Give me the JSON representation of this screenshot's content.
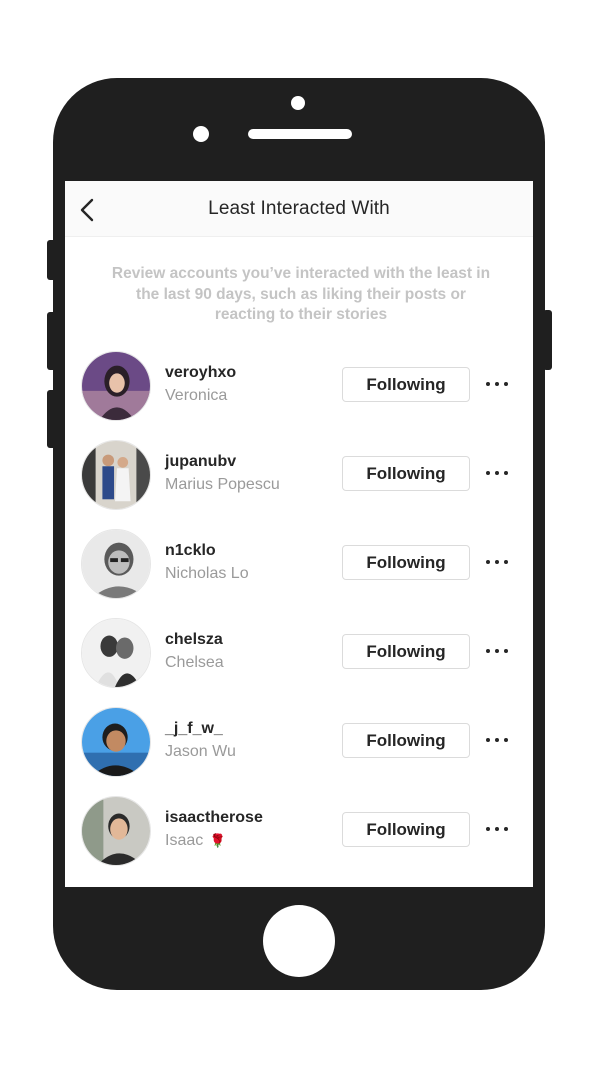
{
  "header": {
    "title": "Least Interacted With",
    "back_icon": "chevron-left-icon"
  },
  "description": "Review accounts you’ve interacted with the least in the last 90 days, such as liking their posts or reacting to their stories",
  "accounts": [
    {
      "username": "veroyhxo",
      "name": "Veronica",
      "button": "Following",
      "more_icon": "more-horizontal-icon"
    },
    {
      "username": "jupanubv",
      "name": "Marius Popescu",
      "button": "Following",
      "more_icon": "more-horizontal-icon"
    },
    {
      "username": "n1cklo",
      "name": "Nicholas Lo",
      "button": "Following",
      "more_icon": "more-horizontal-icon"
    },
    {
      "username": "chelsza",
      "name": "Chelsea",
      "button": "Following",
      "more_icon": "more-horizontal-icon"
    },
    {
      "username": "_j_f_w_",
      "name": "Jason Wu",
      "button": "Following",
      "more_icon": "more-horizontal-icon"
    },
    {
      "username": "isaactherose",
      "name": "Isaac",
      "name_emoji": "🌹",
      "button": "Following",
      "more_icon": "more-horizontal-icon"
    }
  ],
  "colors": {
    "phone_body": "#1f1f1f",
    "text_primary": "#262626",
    "text_secondary": "#9a9a9a",
    "description_text": "#c4c4c4",
    "button_border": "#dbdbdb"
  }
}
